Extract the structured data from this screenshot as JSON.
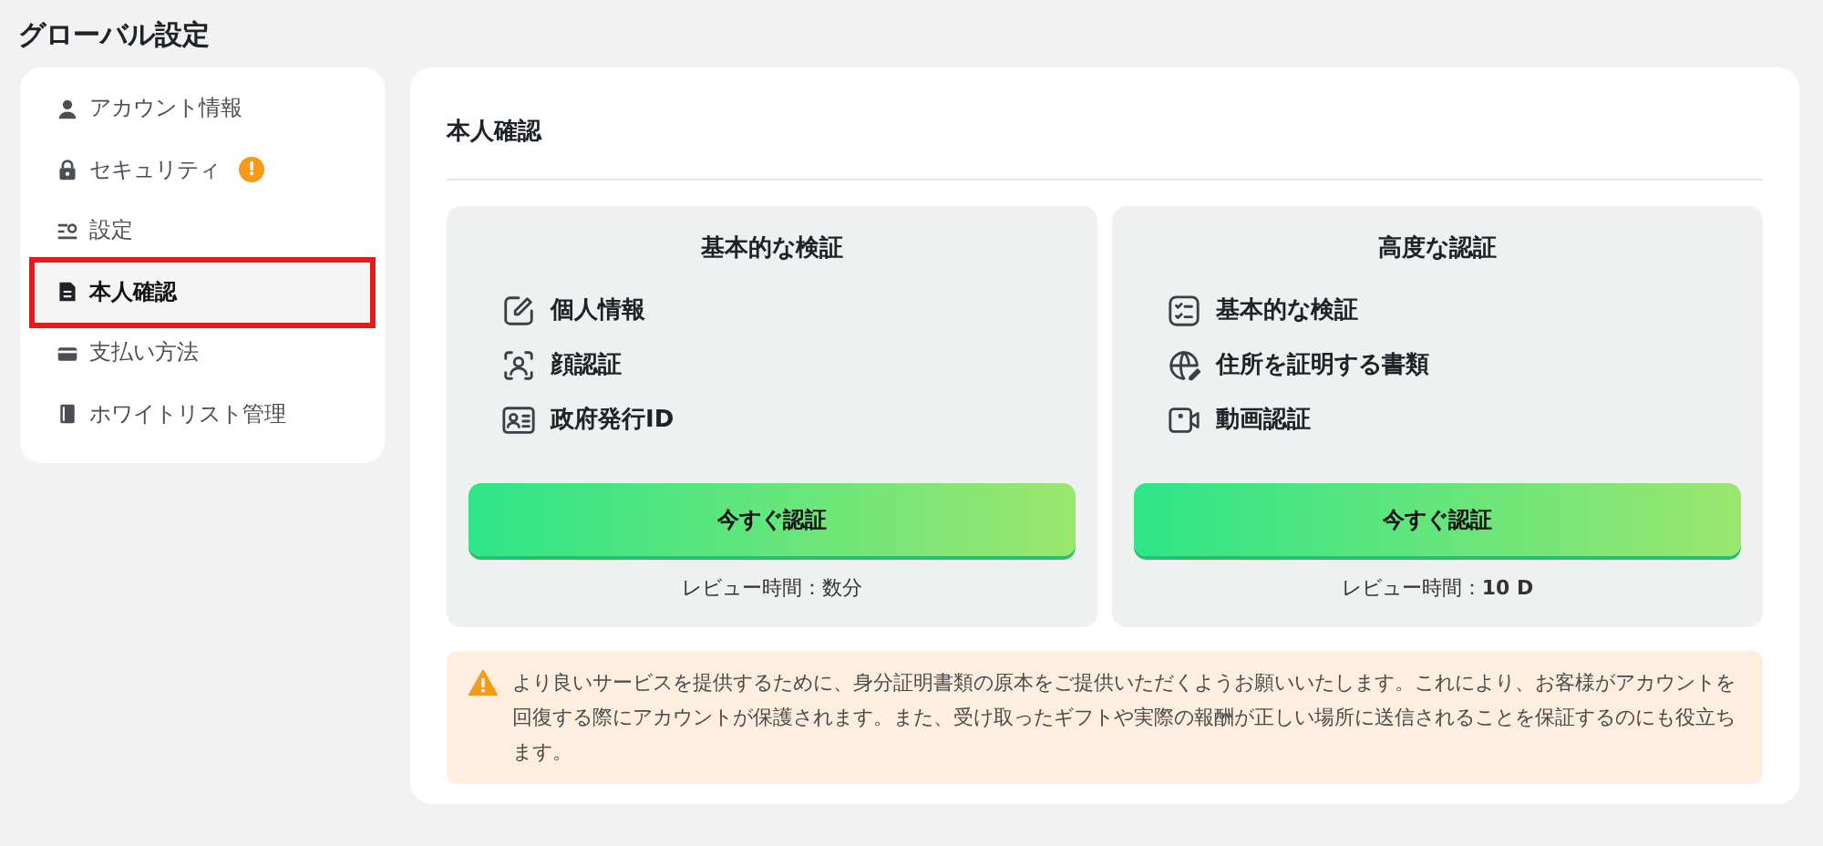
{
  "page_title": "グローバル設定",
  "sidebar": {
    "items": [
      {
        "label": "アカウント情報",
        "kind": "person",
        "selected": false,
        "alert": false
      },
      {
        "label": "セキュリティ",
        "kind": "lock",
        "selected": false,
        "alert": true,
        "alert_text": "!"
      },
      {
        "label": "設定",
        "kind": "sliders",
        "selected": false,
        "alert": false
      },
      {
        "label": "本人確認",
        "kind": "doc",
        "selected": true,
        "alert": false
      },
      {
        "label": "支払い方法",
        "kind": "card",
        "selected": false,
        "alert": false
      },
      {
        "label": "ホワイトリスト管理",
        "kind": "book",
        "selected": false,
        "alert": false
      }
    ]
  },
  "panel": {
    "title": "本人確認",
    "cards": [
      {
        "title": "基本的な検証",
        "features": [
          {
            "kind": "edit",
            "label": "個人情報"
          },
          {
            "kind": "face",
            "label": "顔認証"
          },
          {
            "kind": "id",
            "label": "政府発行ID"
          }
        ],
        "button": "今すぐ認証",
        "review": "レビュー時間：数分"
      },
      {
        "title": "高度な認証",
        "features": [
          {
            "kind": "list",
            "label": "基本的な検証"
          },
          {
            "kind": "globe",
            "label": "住所を証明する書類"
          },
          {
            "kind": "video",
            "label": "動画認証"
          }
        ],
        "button": "今すぐ認証",
        "review": "レビュー時間：**10 D**"
      }
    ],
    "notice": "より良いサービスを提供するために、身分証明書類の原本をご提供いただくようお願いいたします。これにより、お客様がアカウントを回復する際にアカウントが保護されます。また、受け取ったギフトや実際の報酬が正しい場所に送信されることを保証するのにも役立ちます。"
  }
}
